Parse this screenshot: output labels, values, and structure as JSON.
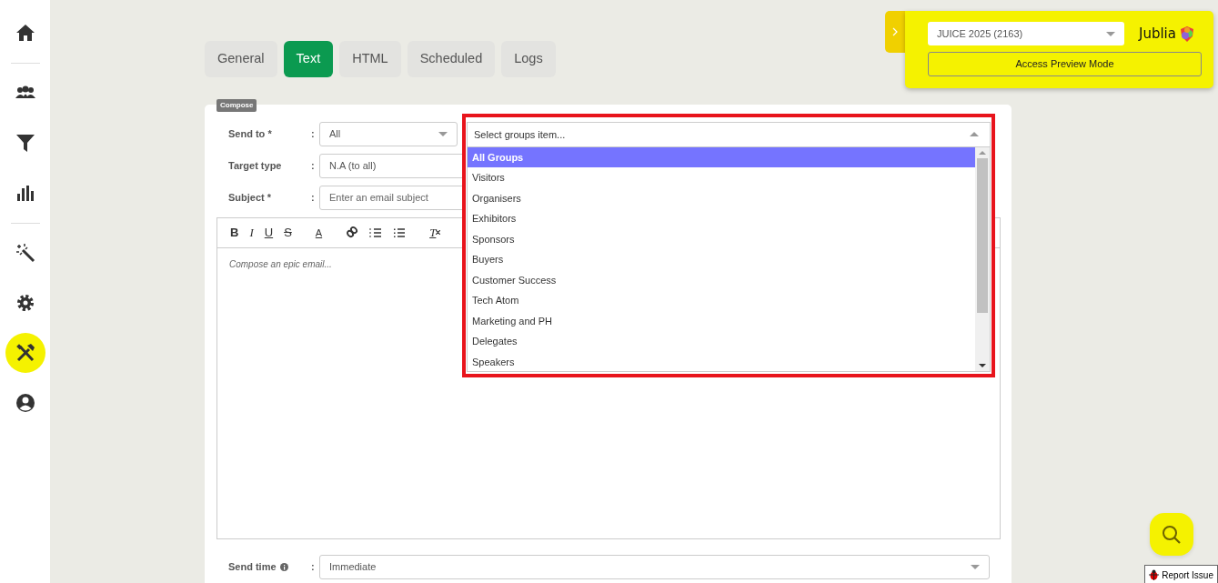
{
  "sidebar": {
    "groups": [
      [
        {
          "kind": "home",
          "selected": false
        }
      ],
      [
        {
          "kind": "users",
          "selected": false
        },
        {
          "kind": "filter",
          "selected": false
        },
        {
          "kind": "chart",
          "selected": false
        }
      ],
      [
        {
          "kind": "wand",
          "selected": false
        },
        {
          "kind": "gear",
          "selected": false
        },
        {
          "kind": "tools",
          "selected": true
        },
        {
          "kind": "user",
          "selected": false
        }
      ]
    ]
  },
  "tabs": [
    {
      "label": "General",
      "selected": false
    },
    {
      "label": "Text",
      "selected": true
    },
    {
      "label": "HTML",
      "selected": false
    },
    {
      "label": "Scheduled",
      "selected": false
    },
    {
      "label": "Logs",
      "selected": false
    }
  ],
  "compose": {
    "badge": "Compose",
    "fields": [
      {
        "label": "Send to *",
        "colon": ":",
        "value": "All",
        "kind": "select"
      },
      {
        "label": "Target type",
        "colon": ":",
        "value": "N.A (to all)",
        "kind": "text"
      },
      {
        "label": "Subject *",
        "colon": ":",
        "placeholder": "Enter an email subject",
        "kind": "text"
      }
    ],
    "toolbar": [
      {
        "kind": "bold",
        "label": "B"
      },
      {
        "kind": "italic",
        "label": "I"
      },
      {
        "kind": "underline",
        "label": "U"
      },
      {
        "kind": "strike",
        "label": "S"
      },
      {
        "kind": "color",
        "label": "A"
      },
      {
        "kind": "link"
      },
      {
        "kind": "ol"
      },
      {
        "kind": "ul"
      },
      {
        "kind": "clear",
        "label": "T"
      }
    ],
    "editor_placeholder": "Compose an epic email...",
    "send_time": {
      "label": "Send time",
      "colon": ":",
      "value": "Immediate"
    }
  },
  "groups_dropdown": {
    "placeholder": "Select groups item...",
    "options": [
      {
        "label": "All Groups",
        "selected": true
      },
      {
        "label": "Visitors",
        "selected": false
      },
      {
        "label": "Organisers",
        "selected": false
      },
      {
        "label": "Exhibitors",
        "selected": false
      },
      {
        "label": "Sponsors",
        "selected": false
      },
      {
        "label": "Buyers",
        "selected": false
      },
      {
        "label": "Customer Success",
        "selected": false
      },
      {
        "label": "Tech Atom",
        "selected": false
      },
      {
        "label": "Marketing and PH",
        "selected": false
      },
      {
        "label": "Delegates",
        "selected": false
      },
      {
        "label": "Speakers",
        "selected": false
      }
    ]
  },
  "event_panel": {
    "event": "JUICE 2025 (2163)",
    "logo": "Jublia",
    "button": "Access Preview Mode"
  },
  "report_issue": "Report Issue"
}
